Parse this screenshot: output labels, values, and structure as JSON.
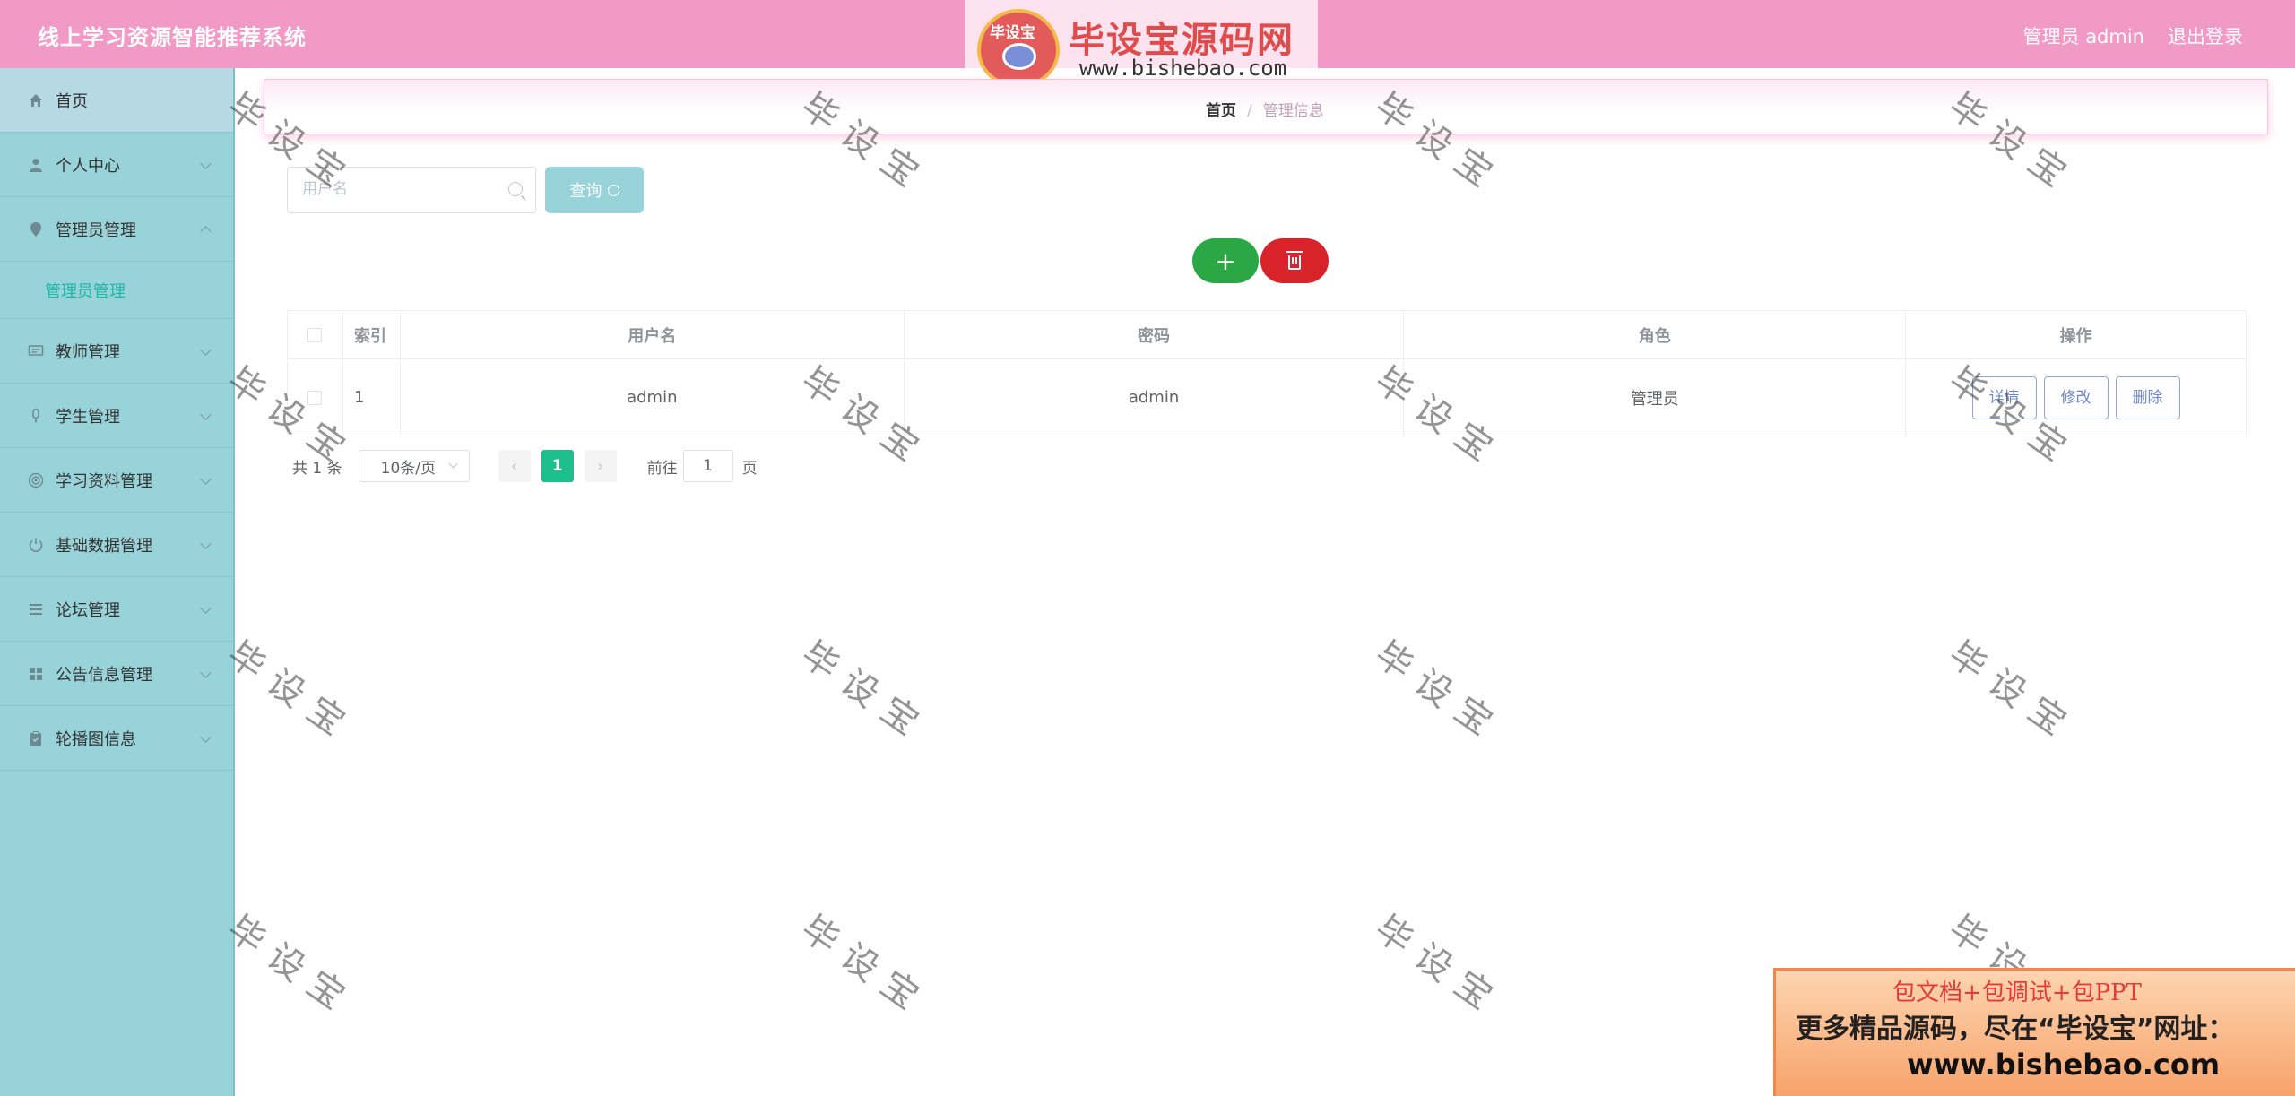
{
  "header": {
    "title": "线上学习资源智能推荐系统",
    "user": "管理员 admin",
    "logout": "退出登录"
  },
  "logo": {
    "badge": "毕设宝",
    "name": "毕设宝源码网",
    "url": "www.bishebao.com"
  },
  "sidebar": {
    "items": [
      {
        "label": "首页",
        "icon": "home-icon"
      },
      {
        "label": "个人中心",
        "icon": "user-icon"
      },
      {
        "label": "管理员管理",
        "icon": "location-icon",
        "expanded": true
      },
      {
        "label": "教师管理",
        "icon": "chat-icon"
      },
      {
        "label": "学生管理",
        "icon": "mic-icon"
      },
      {
        "label": "学习资料管理",
        "icon": "target-icon"
      },
      {
        "label": "基础数据管理",
        "icon": "power-icon"
      },
      {
        "label": "论坛管理",
        "icon": "list-icon"
      },
      {
        "label": "公告信息管理",
        "icon": "grid-icon"
      },
      {
        "label": "轮播图信息",
        "icon": "clipboard-icon"
      }
    ],
    "sub_item": "管理员管理"
  },
  "breadcrumb": {
    "home": "首页",
    "separator": "/",
    "current": "管理信息"
  },
  "search": {
    "placeholder": "用户名",
    "button": "查询"
  },
  "actions": {
    "add": "+"
  },
  "table": {
    "headers": [
      "索引",
      "用户名",
      "密码",
      "角色",
      "操作"
    ],
    "rows": [
      {
        "index": "1",
        "username": "admin",
        "password": "admin",
        "role": "管理员"
      }
    ],
    "ops": [
      "详情",
      "修改",
      "删除"
    ]
  },
  "pagination": {
    "total": "共 1 条",
    "page_size": "10条/页",
    "current": "1",
    "goto": "前往",
    "jump_value": "1",
    "page": "页"
  },
  "watermark": "毕设宝",
  "ad": {
    "line1": "包文档+包调试+包PPT",
    "line2": "更多精品源码，尽在“毕设宝”网址：",
    "line3": "www.bishebao.com"
  },
  "colors": {
    "header": "#f29ac6",
    "sidebar": "#97d3d9",
    "add_button": "#2ba745",
    "delete_button": "#d9232a",
    "page_active": "#1dbf8c"
  }
}
